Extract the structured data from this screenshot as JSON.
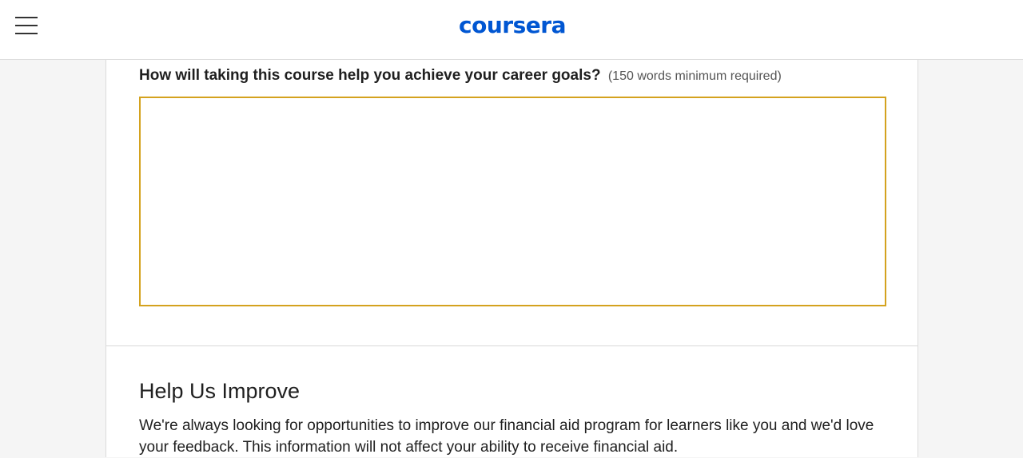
{
  "header": {
    "logo_text": "coursera",
    "logo_color": "#0056d2",
    "menu_icon": "hamburger-menu-icon"
  },
  "form": {
    "question": "How will taking this course help you achieve your career goals?",
    "requirement": "(150 words minimum required)",
    "answer_value": "",
    "focus_color": "#d4a21e"
  },
  "feedback": {
    "title": "Help Us Improve",
    "body": "We're always looking for opportunities to improve our financial aid program for learners like you and we'd love your feedback. This information will not affect your ability to receive financial aid."
  }
}
